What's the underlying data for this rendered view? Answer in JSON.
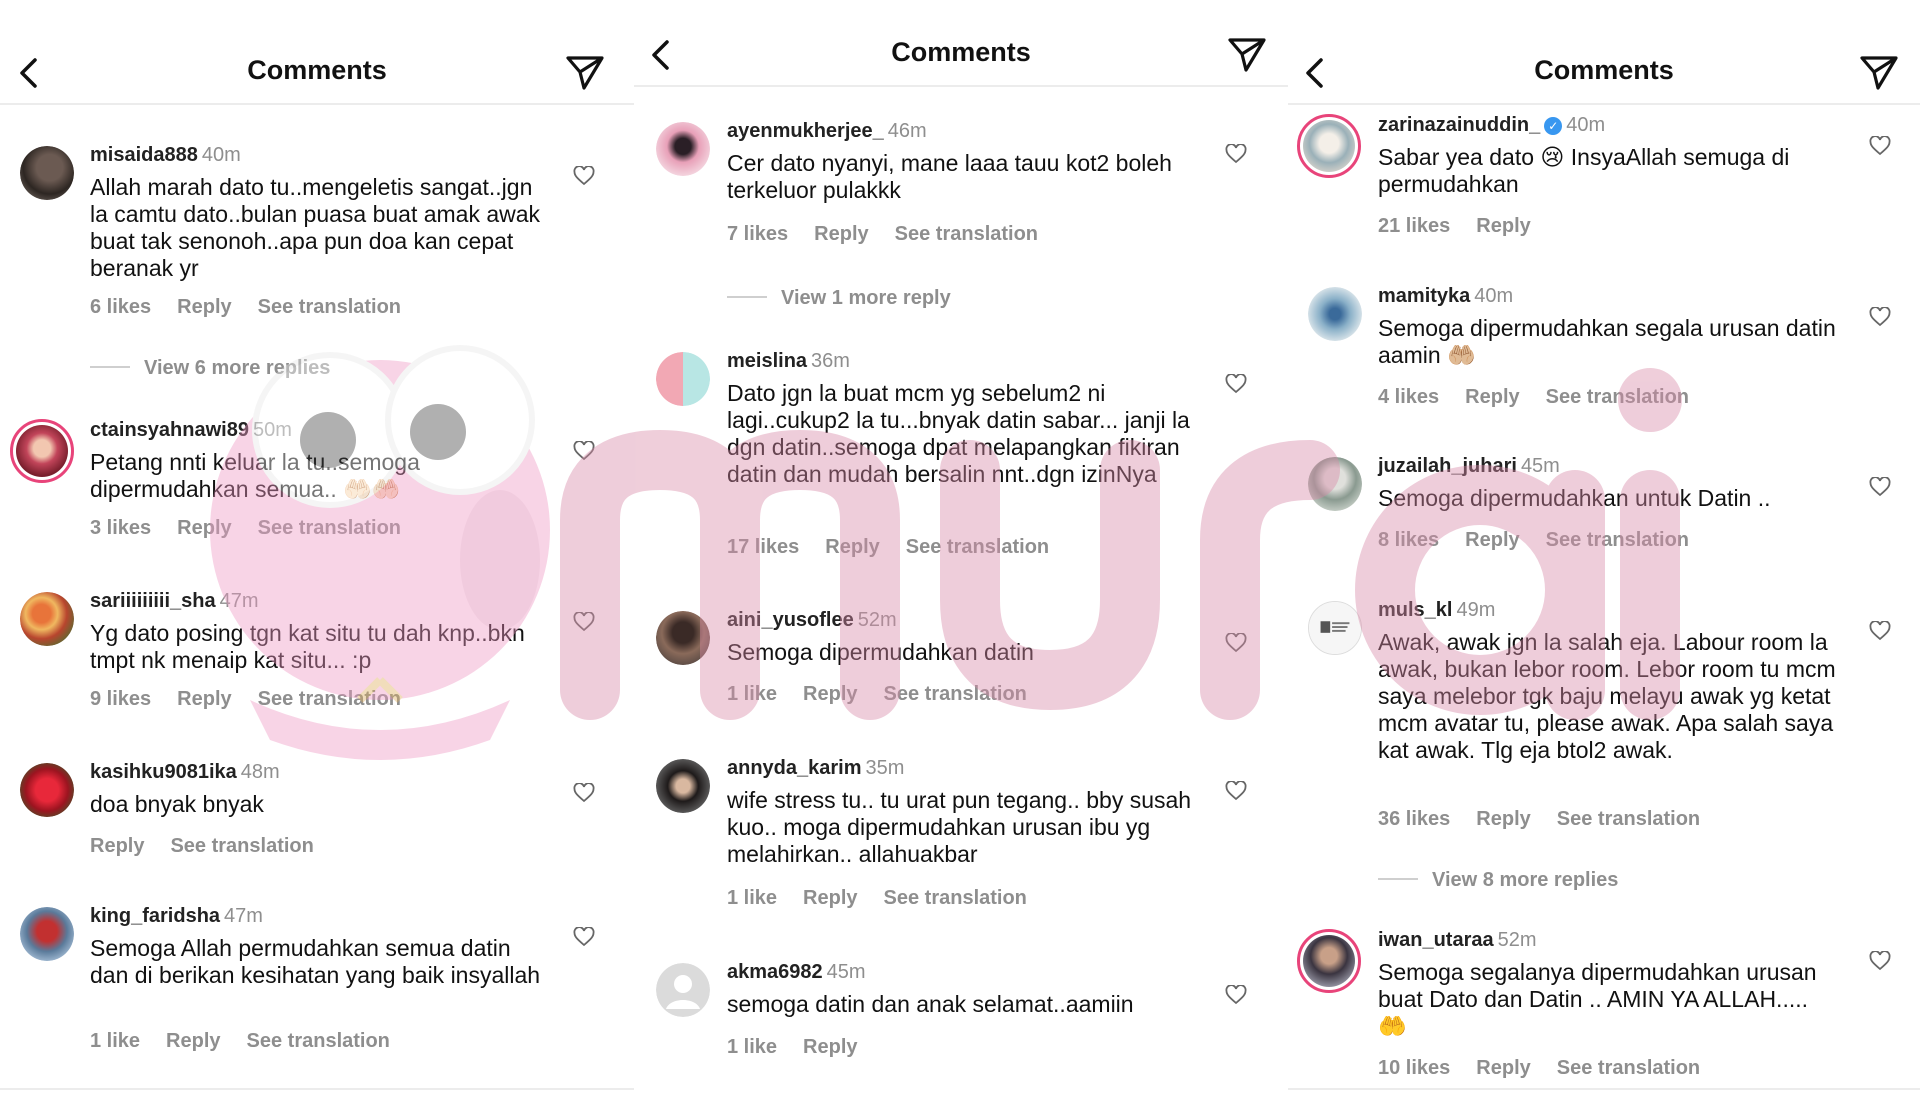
{
  "panels": [
    {
      "title": "Comments",
      "comments": [
        {
          "user": "misaida888",
          "time": "40m",
          "text": "Allah marah dato tu..mengeletis sangat..jgn la camtu dato..bulan puasa buat amak awak buat tak senonoh..apa pun doa kan cepat beranak yr",
          "likes": "6 likes",
          "reply": "Reply",
          "translate": "See translation",
          "more": "View 6 more replies"
        },
        {
          "user": "ctainsyahnawi89",
          "time": "50m",
          "text": "Petang nnti keluar la tu..semoga dipermudahkan semua.. 🤲🏻🤲🏻",
          "likes": "3 likes",
          "reply": "Reply",
          "translate": "See translation"
        },
        {
          "user": "sariiiiiiiii_sha",
          "time": "47m",
          "text": "Yg dato posing tgn kat situ tu dah knp..bkn tmpt nk menaip kat situ... :p",
          "likes": "9 likes",
          "reply": "Reply",
          "translate": "See translation"
        },
        {
          "user": "kasihku9081ika",
          "time": "48m",
          "text": "doa bnyak bnyak",
          "likes": "",
          "reply": "Reply",
          "translate": "See translation"
        },
        {
          "user": "king_faridsha",
          "time": "47m",
          "text": "Semoga Allah permudahkan semua datin dan di berikan kesihatan yang baik insyallah",
          "likes": "1 like",
          "reply": "Reply",
          "translate": "See translation"
        }
      ]
    },
    {
      "title": "Comments",
      "comments": [
        {
          "user": "ayenmukherjee_",
          "time": "46m",
          "text": "Cer dato nyanyi, mane laaa tauu kot2 boleh terkeluor pulakkk",
          "likes": "7 likes",
          "reply": "Reply",
          "translate": "See translation",
          "more": "View 1 more reply"
        },
        {
          "user": "meislina",
          "time": "36m",
          "text": "Dato jgn la buat mcm yg sebelum2 ni lagi..cukup2 la tu...bnyak datin sabar... janji la dgn datin..semoga dpat melapangkan fikiran datin dan mudah bersalin nnt..dgn izinNya",
          "likes": "17 likes",
          "reply": "Reply",
          "translate": "See translation"
        },
        {
          "user": "aini_yusoflee",
          "time": "52m",
          "text": "Semoga dipermudahkan datin",
          "likes": "1 like",
          "reply": "Reply",
          "translate": "See translation"
        },
        {
          "user": "annyda_karim",
          "time": "35m",
          "text": "wife stress tu.. tu urat pun tegang.. bby susah kuo.. moga dipermudahkan urusan ibu yg melahirkan.. allahuakbar",
          "likes": "1 like",
          "reply": "Reply",
          "translate": "See translation"
        },
        {
          "user": "akma6982",
          "time": "45m",
          "text": "semoga datin dan anak selamat..aamiin",
          "likes": "1 like",
          "reply": "Reply",
          "translate": ""
        }
      ]
    },
    {
      "title": "Comments",
      "comments": [
        {
          "user": "zarinazainuddin_",
          "time": "40m",
          "text": "Sabar yea dato 😢 InsyaAllah semuga di permudahkan",
          "likes": "21 likes",
          "reply": "Reply",
          "translate": ""
        },
        {
          "user": "mamityka",
          "time": "40m",
          "text": "Semoga dipermudahkan segala urusan datin aamin 🤲🏼",
          "likes": "4 likes",
          "reply": "Reply",
          "translate": "See translation"
        },
        {
          "user": "juzailah_juhari",
          "time": "45m",
          "text": "Semoga dipermudahkan untuk Datin ..",
          "likes": "8 likes",
          "reply": "Reply",
          "translate": "See translation"
        },
        {
          "user": "muls_kl",
          "time": "49m",
          "text": "Awak, awak jgn la salah eja. Labour room la awak, bukan lebor room. Lebor room tu mcm saya melebor tgk baju melayu awak yg ketat mcm avatar tu, please awak. Apa salah saya kat awak. Tlg eja btol2 awak.",
          "likes": "36 likes",
          "reply": "Reply",
          "translate": "See translation",
          "more": "View 8 more replies"
        },
        {
          "user": "iwan_utaraa",
          "time": "52m",
          "text": "Semoga segalanya dipermudahkan urusan buat Dato dan Datin .. AMIN YA ALLAH..... 🤲",
          "likes": "10 likes",
          "reply": "Reply",
          "translate": "See translation"
        }
      ]
    }
  ],
  "icons": {
    "back": "chevron-left-icon",
    "send": "paper-plane-icon",
    "like": "heart-outline-icon"
  },
  "colors": {
    "text": "#111111",
    "muted": "#8e8e8e",
    "divider": "#ececec",
    "verified": "#3897f0",
    "watermark": "#e9a9c4"
  }
}
